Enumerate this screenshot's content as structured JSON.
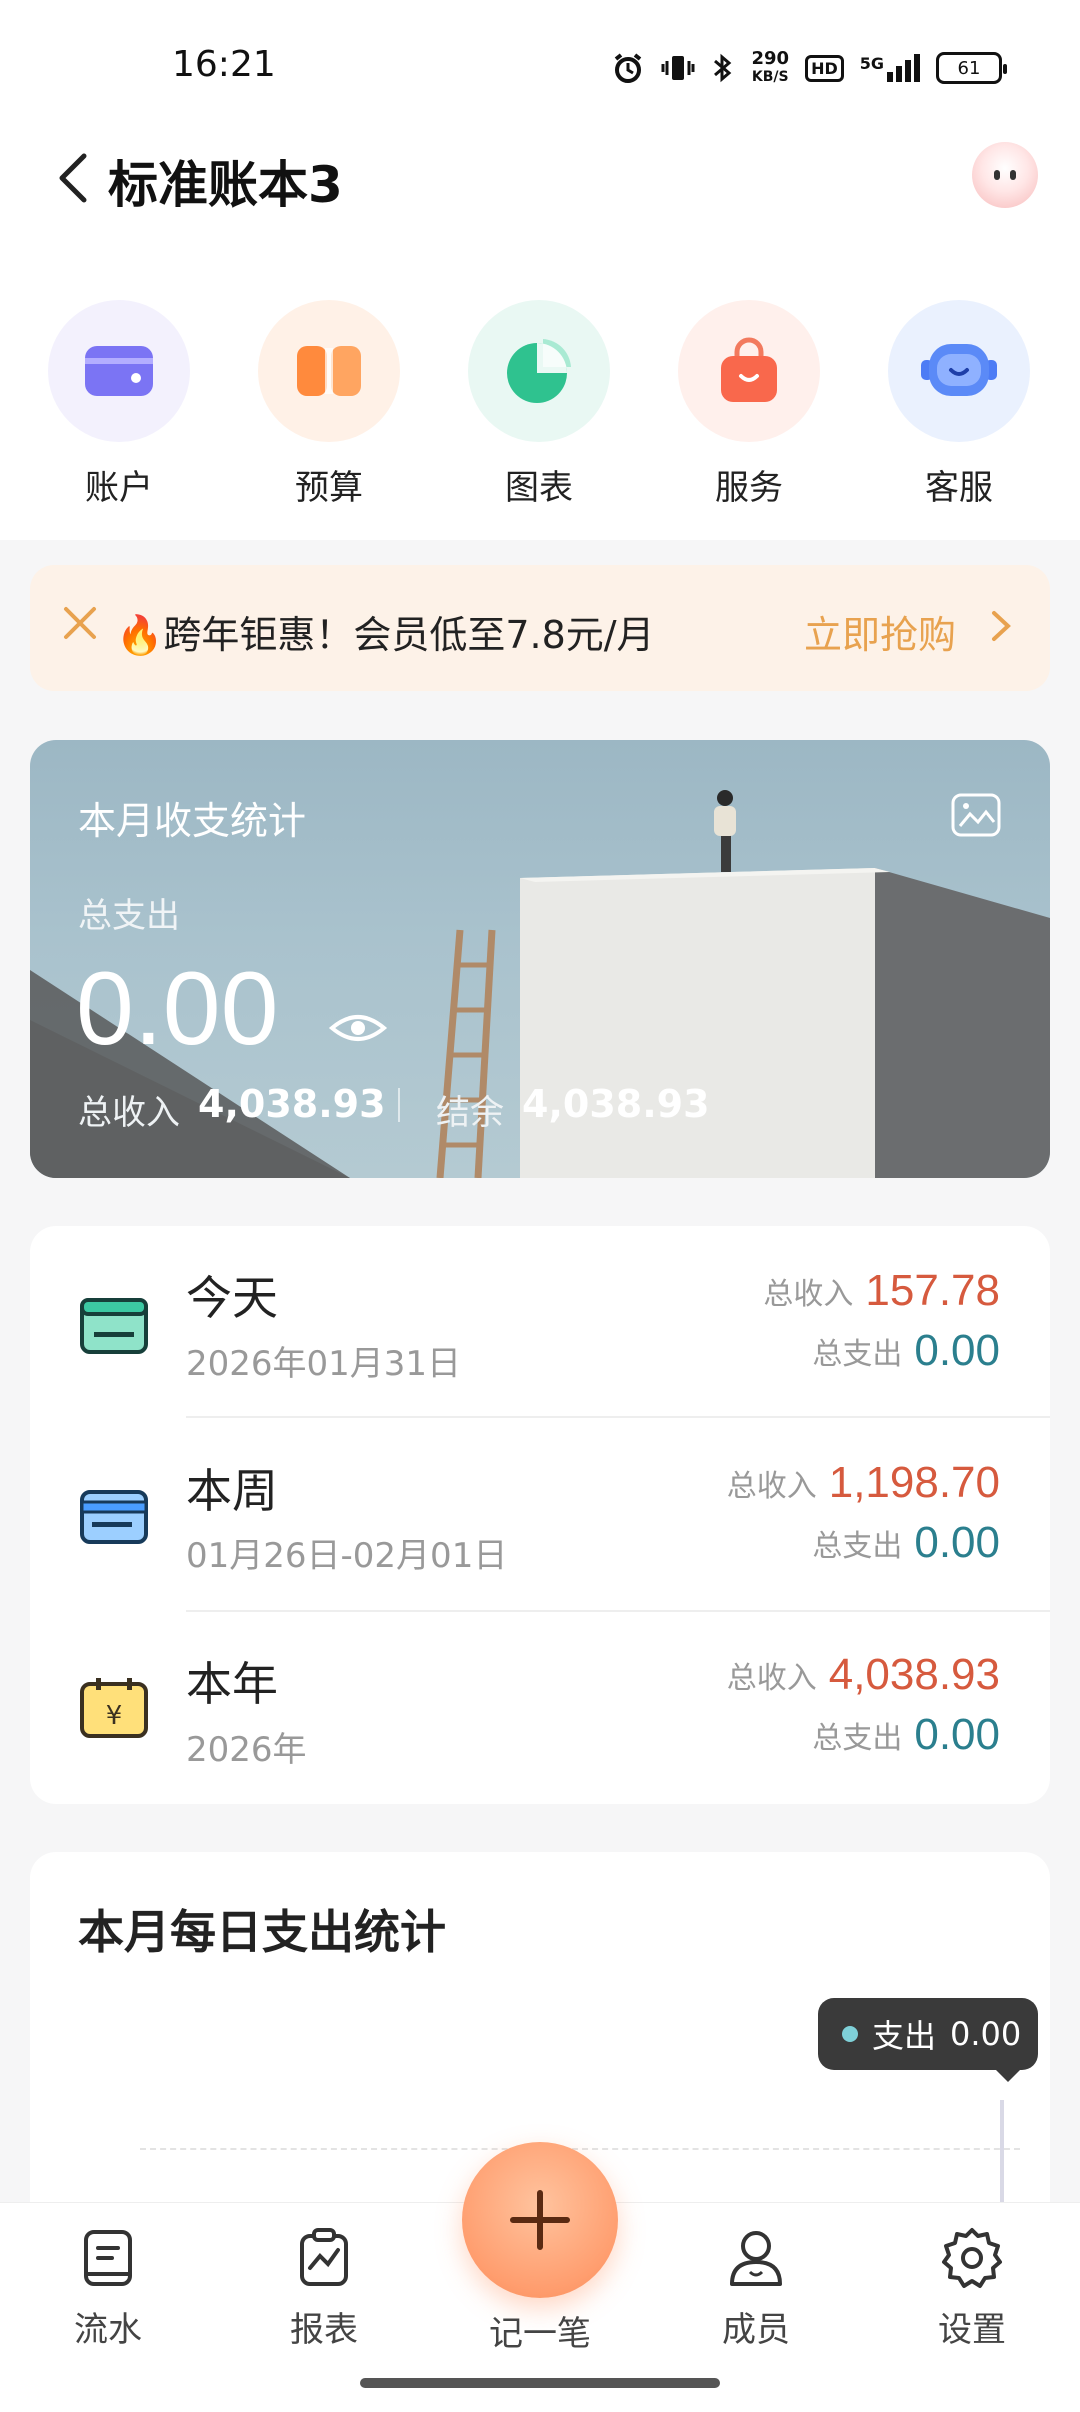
{
  "status_bar": {
    "time": "16:21",
    "net_speed_value": "290",
    "net_speed_unit": "KB/S",
    "hd": "HD",
    "network": "5G",
    "battery": "61"
  },
  "header": {
    "title": "标准账本3"
  },
  "quick_actions": [
    {
      "label": "账户",
      "icon": "wallet-icon"
    },
    {
      "label": "预算",
      "icon": "budget-icon"
    },
    {
      "label": "图表",
      "icon": "pie-chart-icon"
    },
    {
      "label": "服务",
      "icon": "shopping-bag-icon"
    },
    {
      "label": "客服",
      "icon": "robot-support-icon"
    }
  ],
  "promo": {
    "text": "🔥跨年钜惠！会员低至7.8元/月",
    "cta": "立即抢购"
  },
  "hero": {
    "title": "本月收支统计",
    "expense_label": "总支出",
    "expense_amount": "0.00",
    "income_label": "总收入",
    "income_value": "4,038.93",
    "balance_label": "结余",
    "balance_value": "4,038.93"
  },
  "periods": [
    {
      "name": "今天",
      "date": "2026年01月31日",
      "income_label": "总收入",
      "income": "157.78",
      "expense_label": "总支出",
      "expense": "0.00",
      "icon": "calendar-today-icon"
    },
    {
      "name": "本周",
      "date": "01月26日-02月01日",
      "income_label": "总收入",
      "income": "1,198.70",
      "expense_label": "总支出",
      "expense": "0.00",
      "icon": "card-week-icon"
    },
    {
      "name": "本年",
      "date": "2026年",
      "income_label": "总收入",
      "income": "4,038.93",
      "expense_label": "总支出",
      "expense": "0.00",
      "icon": "calendar-yuan-icon"
    }
  ],
  "daily": {
    "title": "本月每日支出统计",
    "tooltip_label": "支出",
    "tooltip_value": "0.00"
  },
  "bottom_nav": [
    {
      "label": "流水",
      "icon": "ledger-icon"
    },
    {
      "label": "报表",
      "icon": "report-icon"
    },
    {
      "label": "记一笔",
      "icon": "plus-icon"
    },
    {
      "label": "成员",
      "icon": "member-icon"
    },
    {
      "label": "设置",
      "icon": "gear-icon"
    }
  ],
  "colors": {
    "income": "#d65a3e",
    "expense": "#2b7f8e",
    "accent": "#ff9d6e",
    "promo_cta": "#e8a24f"
  }
}
